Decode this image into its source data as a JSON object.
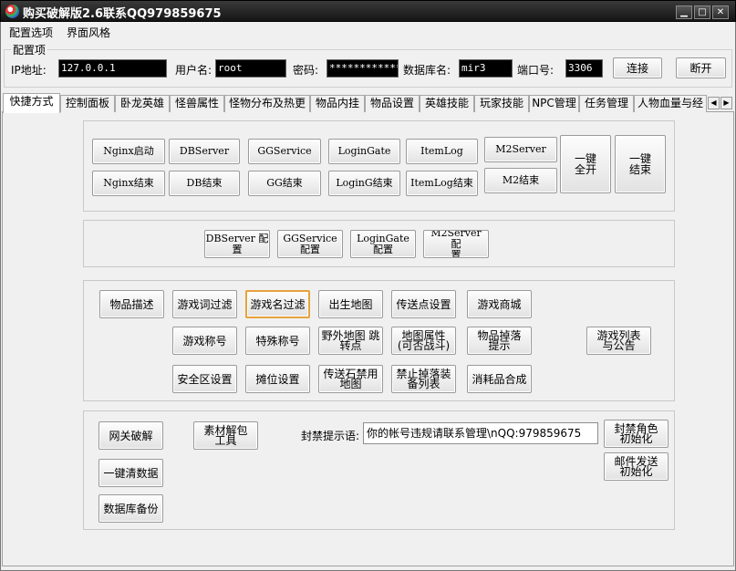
{
  "window": {
    "title": "购买破解版2.6联系QQ979859675",
    "min_glyph": "▁",
    "max_glyph": "□",
    "close_glyph": "✕"
  },
  "menu": {
    "items": [
      "配置选项",
      "界面风格"
    ]
  },
  "config": {
    "group_label": "配置项",
    "ip_label": "IP地址:",
    "ip_value": "127.0.0.1",
    "user_label": "用户名:",
    "user_value": "root",
    "password_label": "密码:",
    "password_value": "*************",
    "db_label": "数据库名:",
    "db_value": "mir3",
    "port_label": "端口号:",
    "port_value": "3306",
    "connect_label": "连接",
    "disconnect_label": "断开"
  },
  "tabs": [
    "快捷方式",
    "控制面板",
    "卧龙英雄",
    "怪兽属性",
    "怪物分布及热更",
    "物品内挂",
    "物品设置",
    "英雄技能",
    "玩家技能",
    "NPC管理",
    "任务管理",
    "人物血量与经"
  ],
  "tab_scroll": {
    "left": "◀",
    "right": "▶"
  },
  "servers": {
    "nginx_start": "Nginx启动",
    "nginx_stop": "Nginx结束",
    "dbserver": "DBServer",
    "db_stop": "DB结束",
    "ggservice": "GGService",
    "gg_stop": "GG结束",
    "logingate": "LoginGate",
    "logingate_stop": "LoginG结束",
    "itemlog": "ItemLog",
    "itemlog_stop": "ItemLog结束",
    "m2server": "M2Server",
    "m2_stop": "M2结束",
    "all_start_1": "一键",
    "all_start_2": "全开",
    "all_stop_1": "一键",
    "all_stop_2": "结束"
  },
  "configs": {
    "dbserver_1": "DBServer 配",
    "dbserver_2": "置",
    "ggservice_1": "GGService",
    "ggservice_2": "配置",
    "logingate_1": "LoginGate",
    "logingate_2": "配置",
    "m2server_1": "M2Server 配",
    "m2server_2": "置"
  },
  "tools": {
    "item_desc": "物品描述",
    "word_filter": "游戏词过滤",
    "name_filter": "游戏名过滤",
    "birth_map": "出生地图",
    "teleport": "传送点设置",
    "shop": "游戏商城",
    "game_title": "游戏称号",
    "special_title": "特殊称号",
    "wild_map_1": "野外地图 跳",
    "wild_map_2": "转点",
    "map_attr_1": "地图属性",
    "map_attr_2": "(可否战斗)",
    "item_drop_1": "物品掉落",
    "item_drop_2": "提示",
    "list_notice_1": "游戏列表",
    "list_notice_2": "与公告",
    "safe_zone": "安全区设置",
    "stall": "摊位设置",
    "teleport_ban_1": "传送石禁用",
    "teleport_ban_2": "地图",
    "ban_drop_1": "禁止掉落装",
    "ban_drop_2": "备列表",
    "consumable": "消耗品合成"
  },
  "misc": {
    "gateway_crack": "网关破解",
    "clear_data": "一键清数据",
    "db_backup": "数据库备份",
    "unpack_1": "素材解包",
    "unpack_2": "工具",
    "ban_label": "封禁提示语:",
    "ban_value": "你的帐号违规请联系管理\\nQQ:979859675",
    "ban_role_1": "封禁角色",
    "ban_role_2": "初始化",
    "mail_1": "邮件发送",
    "mail_2": "初始化"
  }
}
